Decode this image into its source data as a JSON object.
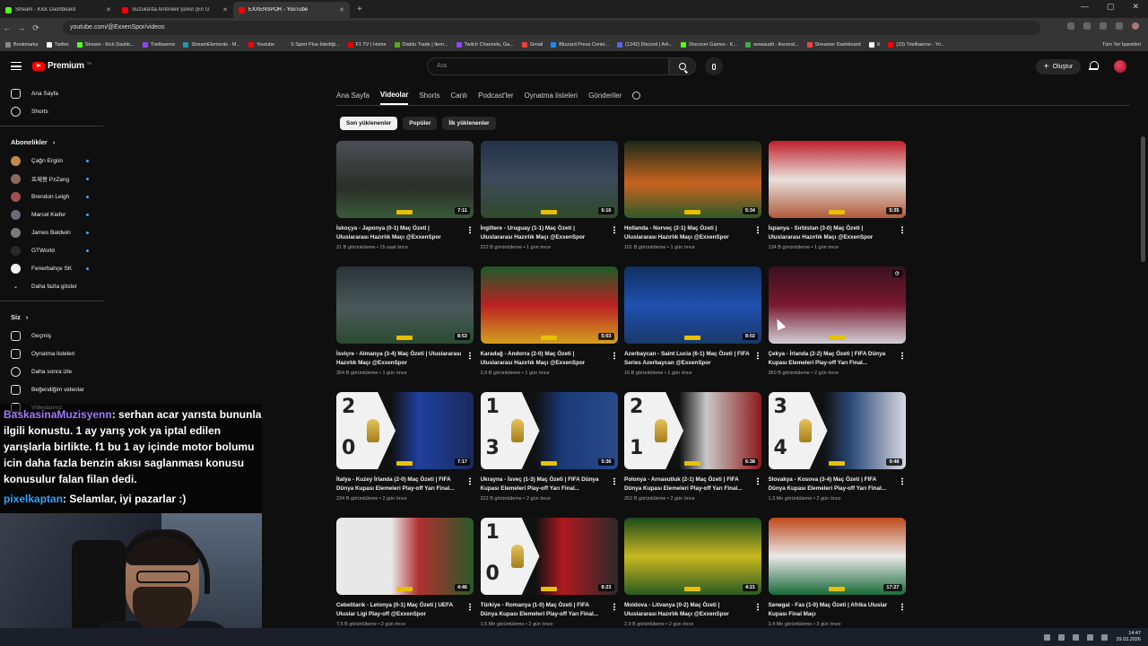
{
  "browser": {
    "tabs": [
      {
        "label": "Stream - Kick Dashboard",
        "color": "#53fc18"
      },
      {
        "label": "Suzuka'da Antonelli Şovu! (En G",
        "color": "#ff0000"
      },
      {
        "label": "EXXENSPOR - YouTube",
        "color": "#ff0000"
      }
    ],
    "url": "youtube.com/@ExxenSpor/videos",
    "bookmarks": [
      "Bookmarks",
      "Twitter",
      "Stream - Kick Dashb...",
      "Trielbaerne",
      "StreamElements - M...",
      "Youtube",
      "S Sport Plus-İstediği...",
      "F1 TV | Home",
      "Diablo Trade | Item...",
      "Twitch Channels, Ga...",
      "Gmail",
      "Blizzard Press Cente...",
      "(1342) Discord | Ark...",
      "Discover Games - K...",
      "wowaudit - Ascend...",
      "Streamer Dashboard",
      "X",
      "(23) Trielbaerne - Yo..."
    ],
    "bookmarks_more": "Tüm Yer İşaretleri"
  },
  "yt": {
    "logo": "Premium",
    "logo_sup": "TR",
    "search_placeholder": "Ara",
    "create_label": "Oluştur",
    "sidebar": {
      "top": [
        "Ana Sayfa",
        "Shorts"
      ],
      "subs_title": "Abonelikler",
      "subs": [
        {
          "name": "Çağrı Ergün",
          "color": "#c28a4a"
        },
        {
          "name": "프제짱 PzZang",
          "color": "#8a6a5a"
        },
        {
          "name": "Brendon Leigh",
          "color": "#a05050"
        },
        {
          "name": "Marcel Kiefer",
          "color": "#6a6a7a"
        },
        {
          "name": "James Baldwin",
          "color": "#7a7a7a"
        },
        {
          "name": "GTWorld",
          "color": "#2a2a2a"
        },
        {
          "name": "Fenerbahçe SK",
          "color": "#f1f1f1"
        }
      ],
      "more": "Daha fazla göster",
      "you_title": "Siz",
      "you": [
        "Geçmiş",
        "Oynatma listeleri",
        "Daha sonra izle",
        "Beğendiğim videolar",
        "Videolarınız"
      ]
    },
    "channel_tabs": [
      "Ana Sayfa",
      "Videolar",
      "Shorts",
      "Canlı",
      "Podcast'ler",
      "Oynatma listeleri",
      "Gönderiler"
    ],
    "selected_tab": "Videolar",
    "chips": [
      "Son yüklenenler",
      "Popüler",
      "İlk yüklenenler"
    ],
    "videos": [
      {
        "title": "İskoçya - Japonya (0-1) Maç Özeti | Uluslararası Hazırlık Maçı @ExxenSpor",
        "meta": "21 B görüntüleme • 15 saat önce",
        "dur": "7:11",
        "bg": "linear-gradient(#4b4f55,#2a2f28 60%,#3a5a3a)",
        "wc": false
      },
      {
        "title": "İngiltere - Uruguay (1-1) Maç Özeti | Uluslararası Hazırlık Maçı @ExxenSpor",
        "meta": "222 B görüntüleme • 1 gün önce",
        "dur": "6:16",
        "bg": "linear-gradient(#23324a,#3d4a5a 50%,#2f4a2a)",
        "wc": false
      },
      {
        "title": "Hollanda - Norveç (2-1) Maç Özeti | Uluslararası Hazırlık Maçı @ExxenSpor",
        "meta": "101 B görüntüleme • 1 gün önce",
        "dur": "5:34",
        "bg": "linear-gradient(#1a2a1a,#c8641e 55%,#2f5a2a)",
        "wc": false
      },
      {
        "title": "İspanya - Sırbistan (3-0) Maç Özeti | Uluslararası Hazırlık Maçı @ExxenSpor",
        "meta": "134 B görüntüleme • 1 gün önce",
        "dur": "5:35",
        "bg": "linear-gradient(#c0202a,#e8e0dc 50%,#b05a3a)",
        "wc": false
      },
      {
        "title": "İsviçre - Almanya (3-4) Maç Özeti | Uluslararası Hazırlık Maçı @ExxenSpor",
        "meta": "354 B görüntüleme • 1 gün önce",
        "dur": "8:53",
        "bg": "linear-gradient(#2a3338,#4a5a5a 55%,#2a4a30)",
        "wc": false
      },
      {
        "title": "Karadağ - Andorra (2-0) Maç Özeti | Uluslararası Hazırlık Maçı @ExxenSpor",
        "meta": "3,9 B görüntüleme • 1 gün önce",
        "dur": "5:03",
        "bg": "linear-gradient(#1d5a2a,#b22 50%,#d4a020)",
        "wc": false
      },
      {
        "title": "Azerbaycan - Saint Lucia (6-1) Maç Özeti | FIFA Series Azerbaycan @ExxenSpor",
        "meta": "16 B görüntüleme • 1 gün önce",
        "dur": "8:02",
        "bg": "linear-gradient(#103060,#2050b0 50%,#1a3a6a)",
        "wc": false
      },
      {
        "title": "Çekya - İrlanda (2-2) Maç Özeti | FIFA Dünya Kupası Elemeleri Play-off Yarı Final...",
        "meta": "350 B görüntüleme • 2 gün önce",
        "dur": "",
        "bg": "linear-gradient(#3a1020,#7a1a30 50%,#d0d0d8)",
        "wc": false
      },
      {
        "title": "İtalya - Kuzey İrlanda (2-0) Maç Özeti | FIFA Dünya Kupası Elemeleri Play-off Yarı Final...",
        "meta": "234 B görüntüleme • 2 gün önce",
        "dur": "7:17",
        "bg": "linear-gradient(90deg,#111 40%,#2040a0 60%,#1a2a5a)",
        "wc": true,
        "n1": "2",
        "n2": "0"
      },
      {
        "title": "Ukrayna - İsveç (1-3) Maç Özeti | FIFA Dünya Kupası Elemeleri Play-off Yarı Final...",
        "meta": "222 B görüntüleme • 2 gün önce",
        "dur": "5:36",
        "bg": "linear-gradient(90deg,#111 40%,#1a3a7a 60%,#2a4a8a)",
        "wc": true,
        "n1": "1",
        "n2": "3"
      },
      {
        "title": "Polonya - Arnavutluk (2-1) Maç Özeti | FIFA Dünya Kupası Elemeleri Play-off Yarı Final...",
        "meta": "252 B görüntüleme • 2 gün önce",
        "dur": "6:38",
        "bg": "linear-gradient(90deg,#111 40%,#c8c8c8 60%,#8a1a1a)",
        "wc": true,
        "n1": "2",
        "n2": "1"
      },
      {
        "title": "Slovakya - Kosova (3-4) Maç Özeti | FIFA Dünya Kupası Elemeleri Play-off Yarı Final...",
        "meta": "1,3 Mn görüntüleme • 2 gün önce",
        "dur": "9:48",
        "bg": "linear-gradient(90deg,#111 40%,#2a4a7a 60%,#d8d8e0)",
        "wc": true,
        "n1": "3",
        "n2": "4"
      },
      {
        "title": "Cebelitarık - Letonya (0-1) Maç Özeti | UEFA Uluslar Ligi Play-off @ExxenSpor",
        "meta": "7,6 B görüntüleme • 2 gün önce",
        "dur": "4:46",
        "bg": "linear-gradient(90deg,#e8e8e8 40%,#b03030 60%,#2a5a2a)",
        "wc": false
      },
      {
        "title": "Türkiye - Romanya (1-0) Maç Özeti | FIFA Dünya Kupası Elemeleri Play-off Yarı Final...",
        "meta": "1,5 Mn görüntüleme • 2 gün önce",
        "dur": "8:23",
        "bg": "linear-gradient(90deg,#111 40%,#b01a20 60%,#2a2a2a)",
        "wc": true,
        "n1": "1",
        "n2": "0"
      },
      {
        "title": "Moldova - Litvanya (0-2) Maç Özeti | Uluslararası Hazırlık Maçı @ExxenSpor",
        "meta": "2,9 B görüntüleme • 2 gün önce",
        "dur": "4:21",
        "bg": "linear-gradient(#1a4a1a,#c8b820 50%,#2a5a20)",
        "wc": false
      },
      {
        "title": "Senegal - Fas (1-0) Maç Özeti | Afrika Uluslar Kupası Final Maçı",
        "meta": "3,4 Mn görüntüleme • 3 gün önce",
        "dur": "17:27",
        "bg": "linear-gradient(#c04a1a,#e8e8e8 50%,#1a6a3a)",
        "wc": false
      }
    ]
  },
  "chat": [
    {
      "user": "BaskasinaMuzisyenn",
      "text": ": serhan acar yarısta bununla ilgili konustu. 1 ay yarış yok ya iptal edilen yarışlarla birlikte. f1 bu 1 ay içinde motor bolumu icin daha fazla benzin akısı saglanması konusu konusulur falan filan dedi."
    },
    {
      "user": "pixelkaptan",
      "text": ": Selamlar, iyi pazarlar :)"
    }
  ],
  "clock": {
    "time": "14:47",
    "date": "29.03.2026"
  }
}
